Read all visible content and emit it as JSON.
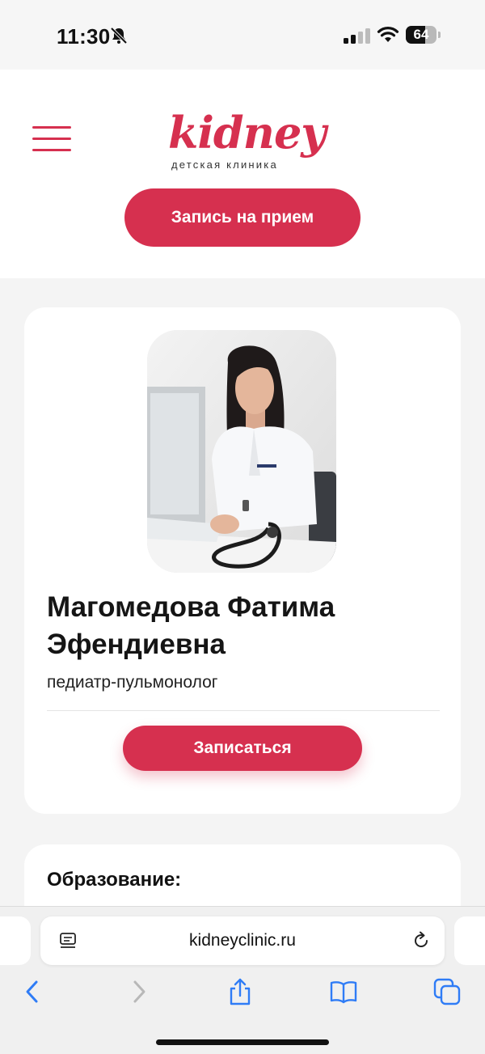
{
  "status_bar": {
    "time": "11:30",
    "battery_level": "64",
    "battery_fraction": 0.64,
    "icons": [
      "bell-slash-icon",
      "cellular-signal-icon",
      "wifi-icon",
      "battery-icon"
    ]
  },
  "header": {
    "logo_word": "kidney",
    "logo_subtitle": "детская клиника",
    "appointment_label": "Запись на прием",
    "menu_icon": "hamburger-menu-icon"
  },
  "doctor": {
    "name": "Магомедова Фатима Эфендиевна",
    "specialty": "педиатр-пульмонолог",
    "signup_label": "Записаться"
  },
  "education": {
    "title": "Образование:"
  },
  "browser": {
    "url": "kidneyclinic.ru",
    "icons": [
      "reader-icon",
      "reload-icon",
      "back-icon",
      "forward-icon",
      "share-icon",
      "bookmarks-icon",
      "tabs-icon"
    ]
  },
  "colors": {
    "brand": "#d6304f",
    "ios_blue": "#2f7cf6",
    "disabled": "#b8b8b8"
  }
}
